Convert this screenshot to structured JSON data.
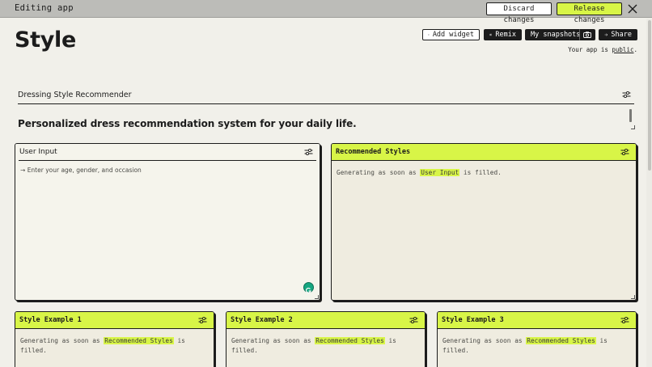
{
  "topbar": {
    "title": "Editing app",
    "discard_label": "Discard changes",
    "release_label": "Release changes",
    "accent": "#d8f547"
  },
  "page": {
    "title": "Style",
    "public_prefix": "Your app is ",
    "public_word": "public",
    "public_suffix": "."
  },
  "actions": {
    "add_widget": "Add widget",
    "remix": "Remix",
    "snapshots": "My snapshots",
    "share": "Share"
  },
  "section": {
    "label": "Dressing Style Recommender",
    "description": "Personalized dress recommendation system for your daily life."
  },
  "panels": {
    "input": {
      "title": "User Input",
      "placeholder": "Enter your age, gender, and occasion"
    },
    "recommended": {
      "title": "Recommended Styles",
      "msg_prefix": "Generating as soon as ",
      "msg_ref": "User Input",
      "msg_suffix": " is filled."
    },
    "examples": [
      {
        "title": "Style Example 1",
        "msg_prefix": "Generating as soon as ",
        "msg_ref": "Recommended Styles",
        "msg_suffix": " is filled."
      },
      {
        "title": "Style Example 2",
        "msg_prefix": "Generating as soon as ",
        "msg_ref": "Recommended Styles",
        "msg_suffix": " is filled."
      },
      {
        "title": "Style Example 3",
        "msg_prefix": "Generating as soon as ",
        "msg_ref": "Recommended Styles",
        "msg_suffix": " is filled."
      }
    ]
  },
  "icons": [
    "close-icon",
    "plus-icon",
    "remix-icon",
    "camera-icon",
    "share-arrow-icon",
    "sliders-icon",
    "arrow-right-icon",
    "grammarly-icon"
  ]
}
